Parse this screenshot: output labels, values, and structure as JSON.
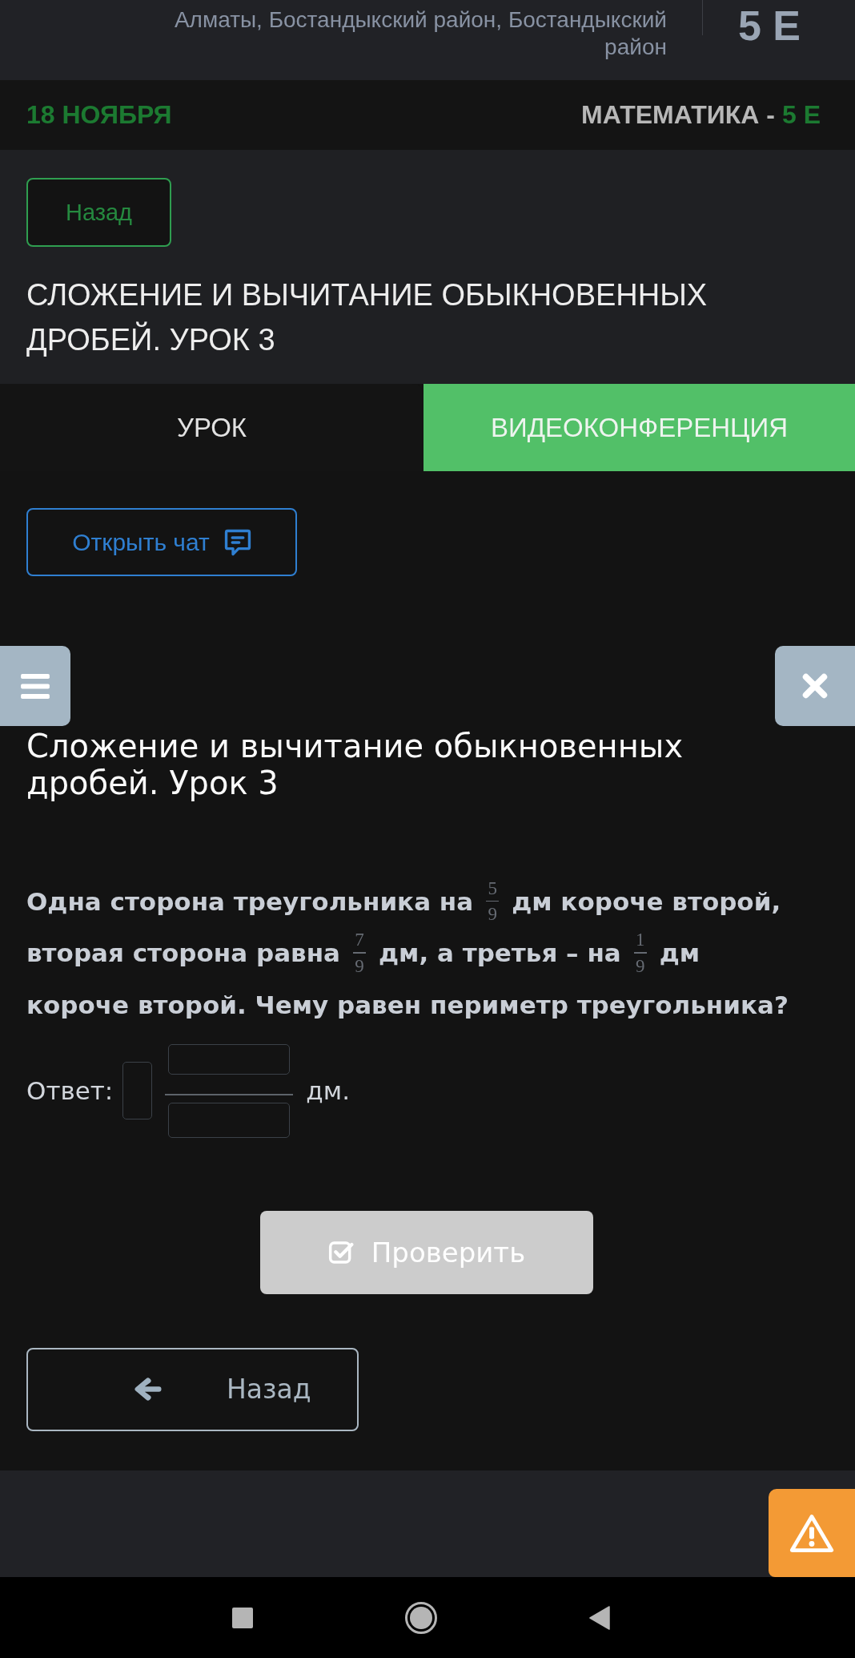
{
  "header": {
    "location": "Алматы, Бостандыкский район, Бостандыкский район",
    "class_label": "5 Е"
  },
  "lesson_bar": {
    "date": "18 НОЯБРЯ",
    "subject": "МАТЕМАТИКА -",
    "class_label": "5 Е"
  },
  "back_button": {
    "label": "Назад"
  },
  "lesson_title": "СЛОЖЕНИЕ И ВЫЧИТАНИЕ ОБЫКНОВЕННЫХ ДРОБЕЙ. УРОК 3",
  "tabs": [
    {
      "label": "УРОК",
      "selected": true
    },
    {
      "label": "ВИДЕОКОНФЕРЕНЦИЯ",
      "selected": false
    }
  ],
  "chat_button": {
    "label": "Открыть чат"
  },
  "task": {
    "title": "Сложение и вычитание обыкновенных дробей. Урок 3",
    "question": [
      {
        "kind": "text",
        "text": "Одна сторона треугольника на"
      },
      {
        "kind": "fraction",
        "numerator": "5",
        "denominator": "9"
      },
      {
        "kind": "text",
        "text": "дм короче второй, вторая сторона равна"
      },
      {
        "kind": "fraction",
        "numerator": "7",
        "denominator": "9"
      },
      {
        "kind": "text",
        "text": "дм, а третья – на"
      },
      {
        "kind": "fraction",
        "numerator": "1",
        "denominator": "9"
      },
      {
        "kind": "text",
        "text": "дм короче второй. Чему равен периметр треугольника?"
      }
    ],
    "answer": {
      "label": "Ответ:",
      "unit": "дм."
    },
    "check_button": {
      "label": "Проверить",
      "disabled": true
    },
    "back_button": {
      "label": "Назад"
    }
  }
}
